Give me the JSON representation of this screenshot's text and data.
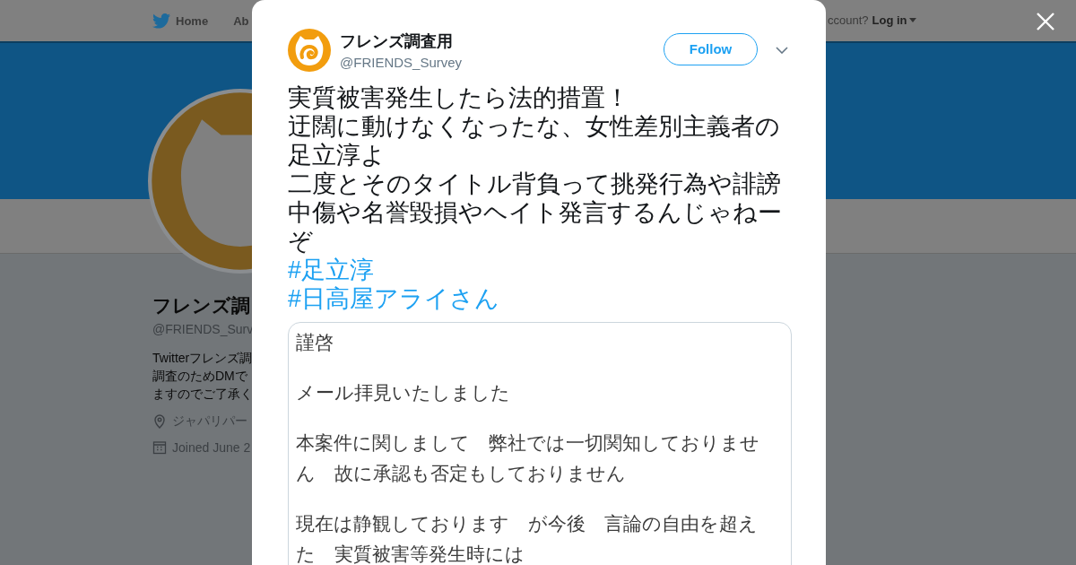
{
  "nav": {
    "items": [
      {
        "label": "Home",
        "kind": "home"
      },
      {
        "label": "Ab",
        "kind": "plain"
      }
    ],
    "account_prompt": "ccount?",
    "login": "Log in"
  },
  "profile": {
    "name": "フレンズ調",
    "handle": "@FRIENDS_Surv",
    "bio": [
      "Twitterフレンズ調",
      "調査のためDMで",
      "ますのでご了承く"
    ],
    "location": "ジャパリパー",
    "joined": "Joined June 2"
  },
  "tweet": {
    "name": "フレンズ調査用",
    "handle": "@FRIENDS_Survey",
    "follow": "Follow",
    "text_lines": [
      "実質被害発生したら法的措置！",
      "迂闊に動けなくなったな、女性差別主義者の足立淳よ",
      "二度とそのタイトル背負って挑発行為や誹謗中傷や名誉毀損やヘイト発言するんじゃねーぞ"
    ],
    "hashtags": [
      "#足立淳",
      "#日高屋アライさん"
    ],
    "attached_document": [
      "謹啓",
      "メール拝見いたしました",
      "本案件に関しまして　弊社では一切関知しておりません　故に承認も否定もしておりません",
      "現在は静観しております　が今後　言論の自由を超えた　実質被害等発生時には"
    ]
  }
}
